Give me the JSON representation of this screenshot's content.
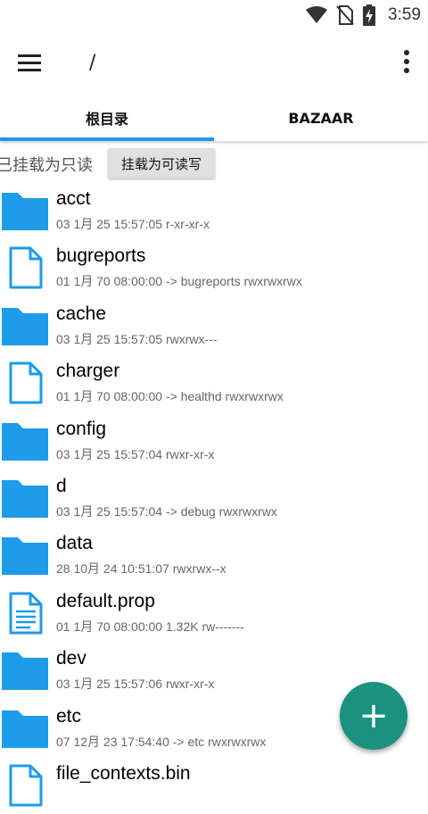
{
  "status_bar": {
    "time": "3:59"
  },
  "toolbar": {
    "path": "/"
  },
  "tabs": [
    {
      "label": "根目录",
      "selected": true
    },
    {
      "label": "BAZAAR",
      "selected": false
    }
  ],
  "mount": {
    "status": "已挂载为只读",
    "button_label": "挂载为可读写"
  },
  "files": [
    {
      "name": "acct",
      "type": "folder",
      "meta": "03 1月 25 15:57:05    r-xr-xr-x"
    },
    {
      "name": "bugreports",
      "type": "file",
      "meta": "01 1月 70 08:00:00  -> bugreports  rwxrwxrwx"
    },
    {
      "name": "cache",
      "type": "folder",
      "meta": "03 1月 25 15:57:05    rwxrwx---"
    },
    {
      "name": "charger",
      "type": "file",
      "meta": "01 1月 70 08:00:00  -> healthd  rwxrwxrwx"
    },
    {
      "name": "config",
      "type": "folder",
      "meta": "03 1月 25 15:57:04    rwxr-xr-x"
    },
    {
      "name": "d",
      "type": "folder",
      "meta": "03 1月 25 15:57:04  -> debug  rwxrwxrwx"
    },
    {
      "name": "data",
      "type": "folder",
      "meta": "28 10月 24 10:51:07    rwxrwx--x"
    },
    {
      "name": "default.prop",
      "type": "doc",
      "meta": "01 1月 70 08:00:00  1.32K  rw-------"
    },
    {
      "name": "dev",
      "type": "folder",
      "meta": "03 1月 25 15:57:06    rwxr-xr-x"
    },
    {
      "name": "etc",
      "type": "folder",
      "meta": "07 12月 23 17:54:40  -> etc  rwxrwxrwx"
    },
    {
      "name": "file_contexts.bin",
      "type": "file",
      "meta": ""
    }
  ],
  "fab": {
    "label": "+"
  },
  "colors": {
    "accent": "#2196f3",
    "folder": "#1e9be9",
    "fab": "#1b9280"
  },
  "icons": {
    "menu": "hamburger-icon",
    "more": "more-vert-icon",
    "folder": "folder-icon",
    "file": "file-icon",
    "doc": "document-icon"
  }
}
